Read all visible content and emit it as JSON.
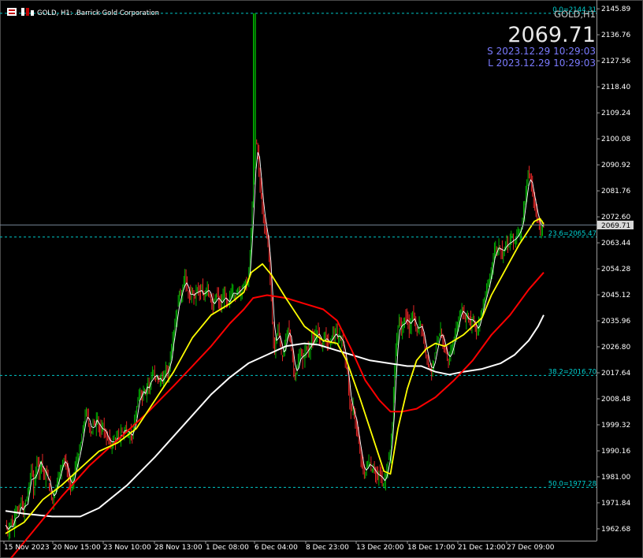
{
  "window": {
    "title": "GOLD, H1: .Barrick Gold Corporation",
    "symbol_tag": "GOLD,H1",
    "last_price": "2069.71",
    "time_s": "S 2023.12.29 10:29:03",
    "time_l": "L 2023.12.29 10:29:03",
    "current_price_label": "2069.71"
  },
  "colors": {
    "background": "#000000",
    "bull": "#00c800",
    "bear": "#ff2a2a",
    "fast_ma": "#ffffff",
    "ma_yellow": "#ffff00",
    "ma_red": "#ff0000",
    "ma_white": "#ffffff",
    "fib": "#00c8c8",
    "price_line": "#708090"
  },
  "chart_data": {
    "type": "line",
    "y_ticks": [
      "2145.89",
      "2136.76",
      "2127.56",
      "2118.40",
      "2109.24",
      "2100.08",
      "2090.92",
      "2081.76",
      "2072.60",
      "2063.44",
      "2054.28",
      "2045.12",
      "2035.96",
      "2026.80",
      "2017.64",
      "2008.48",
      "1999.32",
      "1990.16",
      "1981.00",
      "1971.84",
      "1962.68"
    ],
    "x_ticks": [
      "15 Nov 2023",
      "20 Nov 15:00",
      "23 Nov 10:00",
      "28 Nov 13:00",
      "1 Dec 08:00",
      "6 Dec 04:00",
      "8 Dec 23:00",
      "13 Dec 20:00",
      "18 Dec 17:00",
      "21 Dec 12:00",
      "27 Dec 09:00"
    ],
    "ylim": [
      1958.5,
      2149.0
    ],
    "fib_levels": [
      {
        "label": "0.0=2144.31",
        "value": 2144.31
      },
      {
        "label": "23.6=2065.47",
        "value": 2065.47
      },
      {
        "label": "38.2=2016.70",
        "value": 2016.7
      },
      {
        "label": "50.0=1977.28",
        "value": 1977.28
      }
    ],
    "price_series": [
      [
        0,
        1964
      ],
      [
        3,
        1961
      ],
      [
        6,
        1966
      ],
      [
        8,
        1963
      ],
      [
        11,
        1970
      ],
      [
        14,
        1968
      ],
      [
        17,
        1973
      ],
      [
        19,
        1967
      ],
      [
        21,
        1972
      ],
      [
        24,
        1975
      ],
      [
        26,
        1980
      ],
      [
        28,
        1985
      ],
      [
        30,
        1976
      ],
      [
        32,
        1981
      ],
      [
        34,
        1989
      ],
      [
        36,
        1983
      ],
      [
        38,
        1987
      ],
      [
        40,
        1984
      ],
      [
        42,
        1980
      ],
      [
        44,
        1983
      ],
      [
        46,
        1979
      ],
      [
        48,
        1976
      ],
      [
        50,
        1972
      ],
      [
        52,
        1975
      ],
      [
        54,
        1978
      ],
      [
        56,
        1980
      ],
      [
        58,
        1982
      ],
      [
        60,
        1985
      ],
      [
        62,
        1988
      ],
      [
        64,
        1986
      ],
      [
        66,
        1983
      ],
      [
        68,
        1980
      ],
      [
        70,
        1976
      ],
      [
        72,
        1980
      ],
      [
        74,
        1984
      ],
      [
        76,
        1986
      ],
      [
        78,
        1988
      ],
      [
        80,
        1992
      ],
      [
        82,
        1996
      ],
      [
        84,
        2000
      ],
      [
        86,
        2004
      ],
      [
        88,
        2002
      ],
      [
        90,
        1998
      ],
      [
        92,
        1996
      ],
      [
        94,
        2001
      ],
      [
        96,
        1999
      ],
      [
        98,
        2003
      ],
      [
        100,
        1998
      ],
      [
        102,
        1996
      ],
      [
        104,
        2000
      ],
      [
        106,
        1997
      ],
      [
        108,
        1994
      ],
      [
        110,
        1995
      ],
      [
        112,
        1993
      ],
      [
        114,
        1992
      ],
      [
        116,
        1995
      ],
      [
        118,
        1993
      ],
      [
        120,
        1996
      ],
      [
        122,
        1994
      ],
      [
        124,
        1997
      ],
      [
        126,
        1996
      ],
      [
        128,
        1999
      ],
      [
        130,
        1997
      ],
      [
        132,
        1995
      ],
      [
        134,
        1997
      ],
      [
        136,
        1995
      ],
      [
        138,
        2000
      ],
      [
        140,
        2004
      ],
      [
        142,
        2008
      ],
      [
        144,
        2012
      ],
      [
        146,
        2008
      ],
      [
        148,
        2013
      ],
      [
        150,
        2010
      ],
      [
        152,
        2015
      ],
      [
        154,
        2012
      ],
      [
        156,
        2016
      ],
      [
        158,
        2018
      ],
      [
        160,
        2015
      ],
      [
        162,
        2017
      ],
      [
        164,
        2014
      ],
      [
        166,
        2016
      ],
      [
        168,
        2014
      ],
      [
        170,
        2017
      ],
      [
        172,
        2020
      ],
      [
        174,
        2016
      ],
      [
        176,
        2023
      ],
      [
        178,
        2027
      ],
      [
        180,
        2032
      ],
      [
        182,
        2036
      ],
      [
        184,
        2041
      ],
      [
        186,
        2046
      ],
      [
        188,
        2044
      ],
      [
        190,
        2049
      ],
      [
        192,
        2052
      ],
      [
        194,
        2047
      ],
      [
        196,
        2045
      ],
      [
        198,
        2044
      ],
      [
        200,
        2047
      ],
      [
        202,
        2044
      ],
      [
        204,
        2046
      ],
      [
        206,
        2048
      ],
      [
        208,
        2045
      ],
      [
        210,
        2047
      ],
      [
        212,
        2044
      ],
      [
        214,
        2046
      ],
      [
        216,
        2049
      ],
      [
        218,
        2045
      ],
      [
        220,
        2043
      ],
      [
        222,
        2040
      ],
      [
        224,
        2043
      ],
      [
        226,
        2046
      ],
      [
        228,
        2043
      ],
      [
        230,
        2041
      ],
      [
        232,
        2043
      ],
      [
        234,
        2046
      ],
      [
        236,
        2043
      ],
      [
        238,
        2041
      ],
      [
        240,
        2044
      ],
      [
        242,
        2047
      ],
      [
        244,
        2046
      ],
      [
        246,
        2044
      ],
      [
        248,
        2046
      ],
      [
        250,
        2048
      ],
      [
        252,
        2046
      ],
      [
        254,
        2048
      ],
      [
        256,
        2050
      ],
      [
        258,
        2048
      ],
      [
        260,
        2052
      ],
      [
        262,
        2060
      ],
      [
        264,
        2076
      ],
      [
        266,
        2090
      ],
      [
        268,
        2101
      ],
      [
        270,
        2095
      ],
      [
        272,
        2085
      ],
      [
        274,
        2079
      ],
      [
        276,
        2072
      ],
      [
        278,
        2068
      ],
      [
        280,
        2066
      ],
      [
        282,
        2059
      ],
      [
        284,
        2046
      ],
      [
        286,
        2032
      ],
      [
        288,
        2025
      ],
      [
        290,
        2030
      ],
      [
        292,
        2034
      ],
      [
        294,
        2028
      ],
      [
        296,
        2022
      ],
      [
        298,
        2025
      ],
      [
        300,
        2030
      ],
      [
        302,
        2034
      ],
      [
        304,
        2031
      ],
      [
        306,
        2026
      ],
      [
        308,
        2020
      ],
      [
        310,
        2016
      ],
      [
        312,
        2019
      ],
      [
        314,
        2023
      ],
      [
        316,
        2025
      ],
      [
        318,
        2022
      ],
      [
        320,
        2024
      ],
      [
        322,
        2027
      ],
      [
        324,
        2025
      ],
      [
        326,
        2027
      ],
      [
        328,
        2030
      ],
      [
        330,
        2028
      ],
      [
        332,
        2031
      ],
      [
        334,
        2033
      ],
      [
        336,
        2030
      ],
      [
        338,
        2027
      ],
      [
        340,
        2029
      ],
      [
        342,
        2031
      ],
      [
        344,
        2029
      ],
      [
        346,
        2027
      ],
      [
        348,
        2029
      ],
      [
        350,
        2032
      ],
      [
        352,
        2030
      ],
      [
        354,
        2032
      ],
      [
        356,
        2029
      ],
      [
        358,
        2031
      ],
      [
        360,
        2029
      ],
      [
        362,
        2026
      ],
      [
        364,
        2021
      ],
      [
        366,
        2017
      ],
      [
        368,
        2009
      ],
      [
        370,
        2003
      ],
      [
        372,
        2006
      ],
      [
        374,
        2001
      ],
      [
        376,
        1997
      ],
      [
        378,
        1993
      ],
      [
        380,
        1988
      ],
      [
        382,
        1985
      ],
      [
        384,
        1981
      ],
      [
        386,
        1984
      ],
      [
        388,
        1987
      ],
      [
        390,
        1985
      ],
      [
        392,
        1983
      ],
      [
        394,
        1985
      ],
      [
        396,
        1982
      ],
      [
        398,
        1980
      ],
      [
        400,
        1983
      ],
      [
        402,
        1981
      ],
      [
        404,
        1978
      ],
      [
        406,
        1980
      ],
      [
        408,
        1984
      ],
      [
        410,
        1987
      ],
      [
        412,
        1990
      ],
      [
        414,
        2000
      ],
      [
        416,
        2016
      ],
      [
        418,
        2028
      ],
      [
        420,
        2033
      ],
      [
        422,
        2037
      ],
      [
        424,
        2032
      ],
      [
        426,
        2035
      ],
      [
        428,
        2038
      ],
      [
        430,
        2036
      ],
      [
        432,
        2033
      ],
      [
        434,
        2036
      ],
      [
        436,
        2039
      ],
      [
        438,
        2035
      ],
      [
        440,
        2031
      ],
      [
        442,
        2034
      ],
      [
        444,
        2036
      ],
      [
        446,
        2032
      ],
      [
        448,
        2028
      ],
      [
        450,
        2025
      ],
      [
        452,
        2022
      ],
      [
        454,
        2019
      ],
      [
        456,
        2018
      ],
      [
        458,
        2021
      ],
      [
        460,
        2025
      ],
      [
        462,
        2028
      ],
      [
        464,
        2031
      ],
      [
        466,
        2033
      ],
      [
        468,
        2029
      ],
      [
        470,
        2026
      ],
      [
        472,
        2024
      ],
      [
        474,
        2022
      ],
      [
        476,
        2024
      ],
      [
        478,
        2027
      ],
      [
        480,
        2029
      ],
      [
        482,
        2032
      ],
      [
        484,
        2035
      ],
      [
        486,
        2038
      ],
      [
        488,
        2041
      ],
      [
        490,
        2039
      ],
      [
        492,
        2036
      ],
      [
        494,
        2038
      ],
      [
        496,
        2036
      ],
      [
        498,
        2035
      ],
      [
        500,
        2038
      ],
      [
        502,
        2034
      ],
      [
        504,
        2032
      ],
      [
        506,
        2034
      ],
      [
        508,
        2037
      ],
      [
        510,
        2040
      ],
      [
        512,
        2043
      ],
      [
        514,
        2045
      ],
      [
        516,
        2048
      ],
      [
        518,
        2050
      ],
      [
        520,
        2055
      ],
      [
        522,
        2058
      ],
      [
        524,
        2062
      ],
      [
        526,
        2060
      ],
      [
        528,
        2063
      ],
      [
        530,
        2061
      ],
      [
        532,
        2059
      ],
      [
        534,
        2062
      ],
      [
        536,
        2065
      ],
      [
        538,
        2061
      ],
      [
        540,
        2064
      ],
      [
        542,
        2066
      ],
      [
        544,
        2063
      ],
      [
        546,
        2065
      ],
      [
        548,
        2068
      ],
      [
        550,
        2066
      ],
      [
        552,
        2069
      ],
      [
        554,
        2074
      ],
      [
        556,
        2079
      ],
      [
        558,
        2084
      ],
      [
        560,
        2088
      ],
      [
        562,
        2085
      ],
      [
        564,
        2081
      ],
      [
        566,
        2077
      ],
      [
        568,
        2074
      ],
      [
        570,
        2071
      ],
      [
        572,
        2068
      ],
      [
        574,
        2070
      ],
      [
        576,
        2069.7
      ]
    ],
    "ma_yellow": [
      [
        0,
        1961
      ],
      [
        20,
        1965
      ],
      [
        40,
        1973
      ],
      [
        60,
        1978
      ],
      [
        80,
        1984
      ],
      [
        100,
        1990
      ],
      [
        120,
        1993
      ],
      [
        140,
        1998
      ],
      [
        160,
        2008
      ],
      [
        180,
        2018
      ],
      [
        200,
        2030
      ],
      [
        220,
        2038
      ],
      [
        240,
        2042
      ],
      [
        255,
        2046
      ],
      [
        263,
        2053
      ],
      [
        275,
        2056
      ],
      [
        285,
        2052
      ],
      [
        300,
        2044
      ],
      [
        320,
        2034
      ],
      [
        340,
        2029
      ],
      [
        355,
        2028
      ],
      [
        365,
        2022
      ],
      [
        380,
        2008
      ],
      [
        395,
        1993
      ],
      [
        405,
        1983
      ],
      [
        412,
        1982
      ],
      [
        420,
        1998
      ],
      [
        430,
        2012
      ],
      [
        440,
        2022
      ],
      [
        450,
        2026
      ],
      [
        460,
        2028
      ],
      [
        470,
        2027
      ],
      [
        480,
        2029
      ],
      [
        490,
        2031
      ],
      [
        500,
        2034
      ],
      [
        510,
        2037
      ],
      [
        520,
        2045
      ],
      [
        530,
        2051
      ],
      [
        540,
        2057
      ],
      [
        550,
        2063
      ],
      [
        560,
        2068
      ],
      [
        566,
        2071
      ],
      [
        572,
        2072
      ],
      [
        576,
        2070
      ]
    ],
    "ma_red": [
      [
        0,
        1950
      ],
      [
        30,
        1962
      ],
      [
        60,
        1974
      ],
      [
        90,
        1985
      ],
      [
        120,
        1994
      ],
      [
        150,
        2003
      ],
      [
        180,
        2013
      ],
      [
        200,
        2020
      ],
      [
        220,
        2027
      ],
      [
        240,
        2035
      ],
      [
        255,
        2040
      ],
      [
        265,
        2044
      ],
      [
        280,
        2045
      ],
      [
        300,
        2044
      ],
      [
        320,
        2042
      ],
      [
        340,
        2040
      ],
      [
        355,
        2036
      ],
      [
        370,
        2026
      ],
      [
        385,
        2015
      ],
      [
        400,
        2008
      ],
      [
        412,
        2004
      ],
      [
        425,
        2004
      ],
      [
        440,
        2005
      ],
      [
        460,
        2009
      ],
      [
        480,
        2015
      ],
      [
        500,
        2022
      ],
      [
        520,
        2031
      ],
      [
        540,
        2038
      ],
      [
        560,
        2047
      ],
      [
        576,
        2053
      ]
    ],
    "ma_white": [
      [
        0,
        1969
      ],
      [
        20,
        1968
      ],
      [
        50,
        1967
      ],
      [
        80,
        1967
      ],
      [
        100,
        1970
      ],
      [
        130,
        1978
      ],
      [
        160,
        1988
      ],
      [
        190,
        1999
      ],
      [
        220,
        2010
      ],
      [
        240,
        2016
      ],
      [
        260,
        2021
      ],
      [
        280,
        2024
      ],
      [
        300,
        2027
      ],
      [
        320,
        2028
      ],
      [
        335,
        2027.5
      ],
      [
        350,
        2026
      ],
      [
        370,
        2024
      ],
      [
        390,
        2022
      ],
      [
        410,
        2021
      ],
      [
        430,
        2020
      ],
      [
        445,
        2020
      ],
      [
        460,
        2018
      ],
      [
        475,
        2017
      ],
      [
        490,
        2018
      ],
      [
        510,
        2019
      ],
      [
        530,
        2021
      ],
      [
        545,
        2024
      ],
      [
        560,
        2029
      ],
      [
        570,
        2034
      ],
      [
        576,
        2038
      ]
    ]
  }
}
